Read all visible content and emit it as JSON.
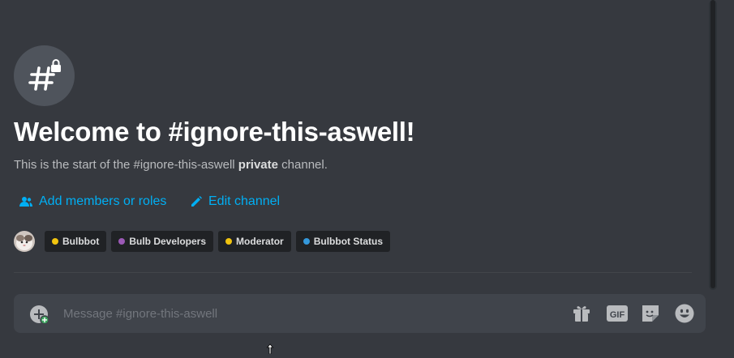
{
  "welcome": {
    "title": "Welcome to #ignore-this-aswell!",
    "subtitle_prefix": "This is the start of the #ignore-this-aswell ",
    "subtitle_bold": "private",
    "subtitle_suffix": " channel."
  },
  "actions": {
    "add_members_label": "Add members or roles",
    "edit_channel_label": "Edit channel"
  },
  "roles": [
    {
      "name": "Bulbbot",
      "color": "#f1c40f"
    },
    {
      "name": "Bulb Developers",
      "color": "#9b59b6"
    },
    {
      "name": "Moderator",
      "color": "#f1c40f"
    },
    {
      "name": "Bulbbot Status",
      "color": "#3498db"
    }
  ],
  "composer": {
    "placeholder": "Message #ignore-this-aswell",
    "gif_label": "GIF"
  },
  "icons": {
    "channel": "hashtag-lock-icon",
    "add_members": "people-icon",
    "edit": "pencil-icon",
    "upload": "plus-circle-icon",
    "gift": "gift-icon",
    "gif": "gif-icon",
    "sticker": "sticker-icon",
    "emoji": "emoji-icon"
  },
  "colors": {
    "background": "#36393f",
    "link": "#00aff4",
    "composer_bg": "#40444b",
    "pill_bg": "#202225"
  }
}
